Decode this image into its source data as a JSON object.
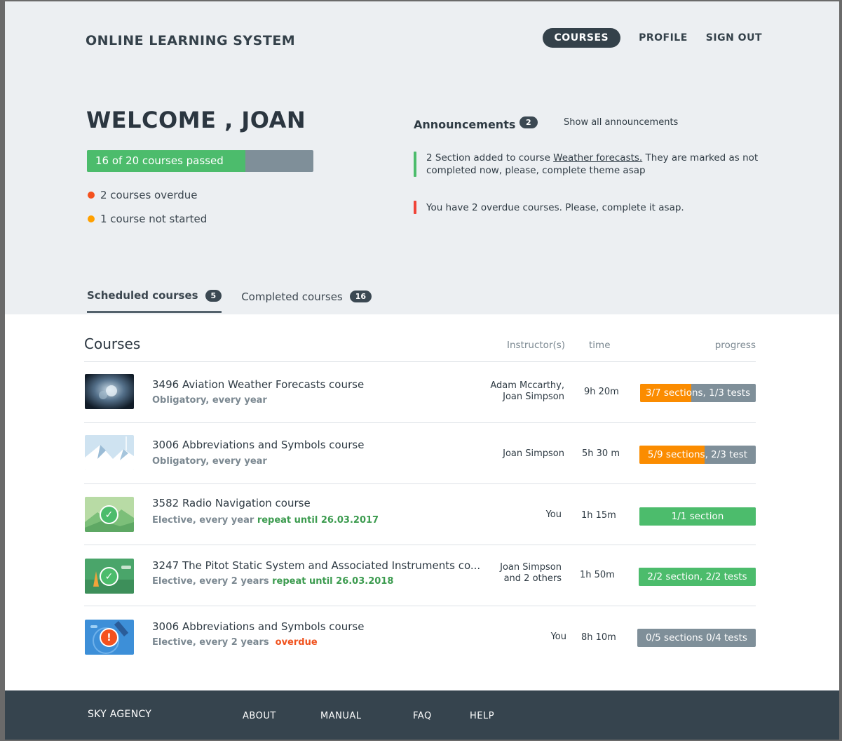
{
  "header": {
    "brand": "ONLINE LEARNING SYSTEM",
    "nav": {
      "courses": "COURSES",
      "profile": "PROFILE",
      "sign_out": "SIGN OUT"
    }
  },
  "welcome": {
    "title": "WELCOME , JOAN",
    "progress_label": "16 of 20 courses passed",
    "progress_fraction": 0.7,
    "overdue": "2 courses overdue",
    "not_started": "1 course not started"
  },
  "announcements": {
    "title": "Announcements",
    "count": "2",
    "show_all": "Show all announcements",
    "items": [
      {
        "before": "2 Section added to course ",
        "link": "Weather forecasts.",
        "after": " They are marked as not completed now, please, complete theme asap",
        "color": "#4cbc6c"
      },
      {
        "text": "You have 2 overdue courses. Please, complete it asap.",
        "color": "#f04438"
      }
    ]
  },
  "tabs": {
    "scheduled": "Scheduled courses",
    "scheduled_count": "5",
    "completed": "Completed courses",
    "completed_count": "16"
  },
  "courses": {
    "title": "Courses",
    "col_instructor": "Instructor(s)",
    "col_time": "time",
    "col_progress": "progress",
    "rows": [
      {
        "title": "3496 Aviation Weather Forecasts course",
        "sub": "Obligatory, every year",
        "extra": "",
        "instr1": "Adam Mccarthy,",
        "instr2": "Joan Simpson",
        "time": "9h 20m",
        "progress": "3/7 sections, 1/3 tests",
        "fraction": 0.44,
        "color": "#fb8c00",
        "thumb": "storm-thumbnail"
      },
      {
        "title": "3006 Abbreviations and Symbols course",
        "sub": "Obligatory, every year",
        "extra": "",
        "instr1": "Joan Simpson",
        "instr2": "",
        "time": "5h 30 m",
        "progress": "5/9 sections, 2/3 test",
        "fraction": 0.56,
        "color": "#fb8c00",
        "thumb": "mountain-thumbnail"
      },
      {
        "title": "3582 Radio Navigation course",
        "sub": "Elective, every year",
        "extra": "repeat until 26.03.2017",
        "instr1": "You",
        "instr2": "",
        "time": "1h 15m",
        "progress": "1/1 section",
        "fraction": 1.0,
        "color": "#4cbc6c",
        "thumb": "hills-thumbnail"
      },
      {
        "title": "3247 The Pitot Static System and Associated Instruments  co...",
        "sub": "Elective, every 2 years",
        "extra": "repeat until 26.03.2018",
        "instr1": "Joan Simpson",
        "instr2": "and 2 others",
        "time": "1h 50m",
        "progress": "2/2 section, 2/2 tests",
        "fraction": 1.0,
        "color": "#4cbc6c",
        "thumb": "landscape-thumbnail"
      },
      {
        "title": "3006 Abbreviations and Symbols course",
        "sub": "Elective, every 2 years",
        "extra": "overdue",
        "instr1": "You",
        "instr2": "",
        "time": "8h 10m",
        "progress": "0/5 sections 0/4 tests",
        "fraction": 0.0,
        "color": "#7f8f99",
        "thumb": "satellite-thumbnail"
      }
    ]
  },
  "footer": {
    "brand": "SKY AGENCY",
    "about": "ABOUT",
    "manual": "MANUAL",
    "faq": "FAQ",
    "help": "HELP"
  }
}
